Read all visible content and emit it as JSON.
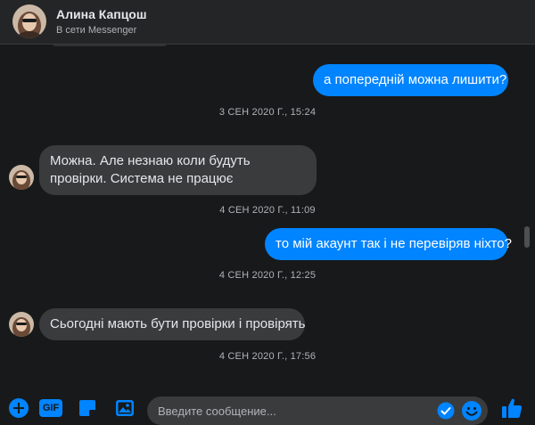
{
  "header": {
    "contact_name": "Алина Капцош",
    "status": "В сети Messenger"
  },
  "messages": [
    {
      "type": "outgoing",
      "text": "а попередній можна лишити?"
    },
    {
      "type": "timestamp",
      "text": "3 СЕН 2020 Г., 15:24"
    },
    {
      "type": "incoming",
      "text": "Можна. Але незнаю коли будуть провірки. Система не працює"
    },
    {
      "type": "timestamp",
      "text": "4 СЕН 2020 Г., 11:09"
    },
    {
      "type": "outgoing",
      "text": "то мій акаунт так і не перевіряв ніхто?"
    },
    {
      "type": "timestamp",
      "text": "4 СЕН 2020 Г., 12:25"
    },
    {
      "type": "incoming",
      "text": "Сьогодні мають бути провірки і провірять"
    },
    {
      "type": "timestamp",
      "text": "4 СЕН 2020 Г., 17:56"
    }
  ],
  "composer": {
    "gif_label": "GIF",
    "placeholder": "Введите сообщение..."
  },
  "icons": {
    "add": "plus-circle-icon",
    "gif": "gif-icon",
    "sticker": "sticker-icon",
    "image": "image-icon",
    "seen": "check-circle-icon",
    "emoji": "emoji-icon",
    "like": "thumbs-up-icon"
  },
  "colors": {
    "accent": "#0084ff",
    "background": "#18191a",
    "incoming_bubble": "#3a3b3c",
    "muted_text": "#b0b3b8"
  }
}
